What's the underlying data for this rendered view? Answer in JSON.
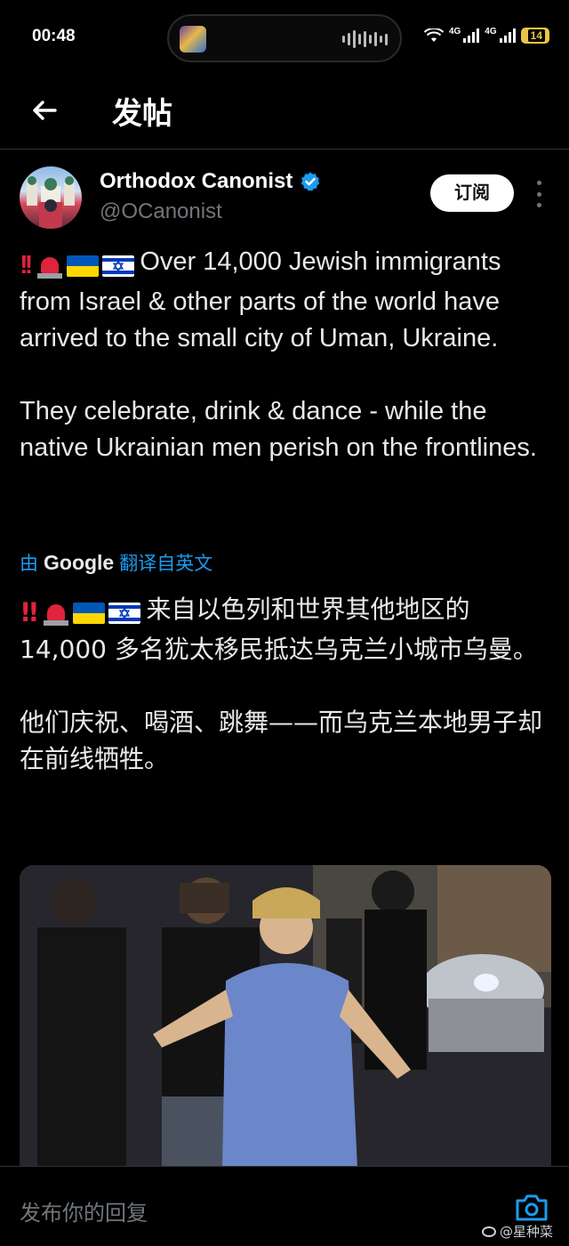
{
  "status_bar": {
    "time": "00:48",
    "network_1": "4G",
    "network_2": "4G",
    "battery": "14"
  },
  "header": {
    "title": "发帖"
  },
  "author": {
    "name": "Orthodox Canonist",
    "handle": "@OCanonist",
    "subscribe_label": "订阅"
  },
  "tweet": {
    "emoji_prefix": [
      "double-exclamation",
      "police-siren",
      "ukraine-flag",
      "israel-flag"
    ],
    "text_en_p1": "Over 14,000 Jewish immigrants from Israel & other parts of the world have arrived to the small city of Uman, Ukraine.",
    "text_en_p2": "They celebrate, drink & dance - while the native Ukrainian men perish on the frontlines.",
    "translate_prefix": "由",
    "translate_brand": "Google",
    "translate_suffix": "翻译自英文",
    "text_zh_p1": "来自以色列和世界其他地区的 14,000 多名犹太移民抵达乌克兰小城市乌曼。",
    "text_zh_p2": "他们庆祝、喝酒、跳舞——而乌克兰本地男子却在前线牺牲。",
    "media": "video-frame-crowd-street-night"
  },
  "reply": {
    "placeholder": "发布你的回复"
  },
  "watermark": "@星种菜",
  "colors": {
    "background": "#000000",
    "text": "#e7e9ea",
    "secondary_text": "#71767b",
    "link": "#1d9bf0",
    "verified": "#1d9bf0",
    "divider": "#2f3336"
  }
}
